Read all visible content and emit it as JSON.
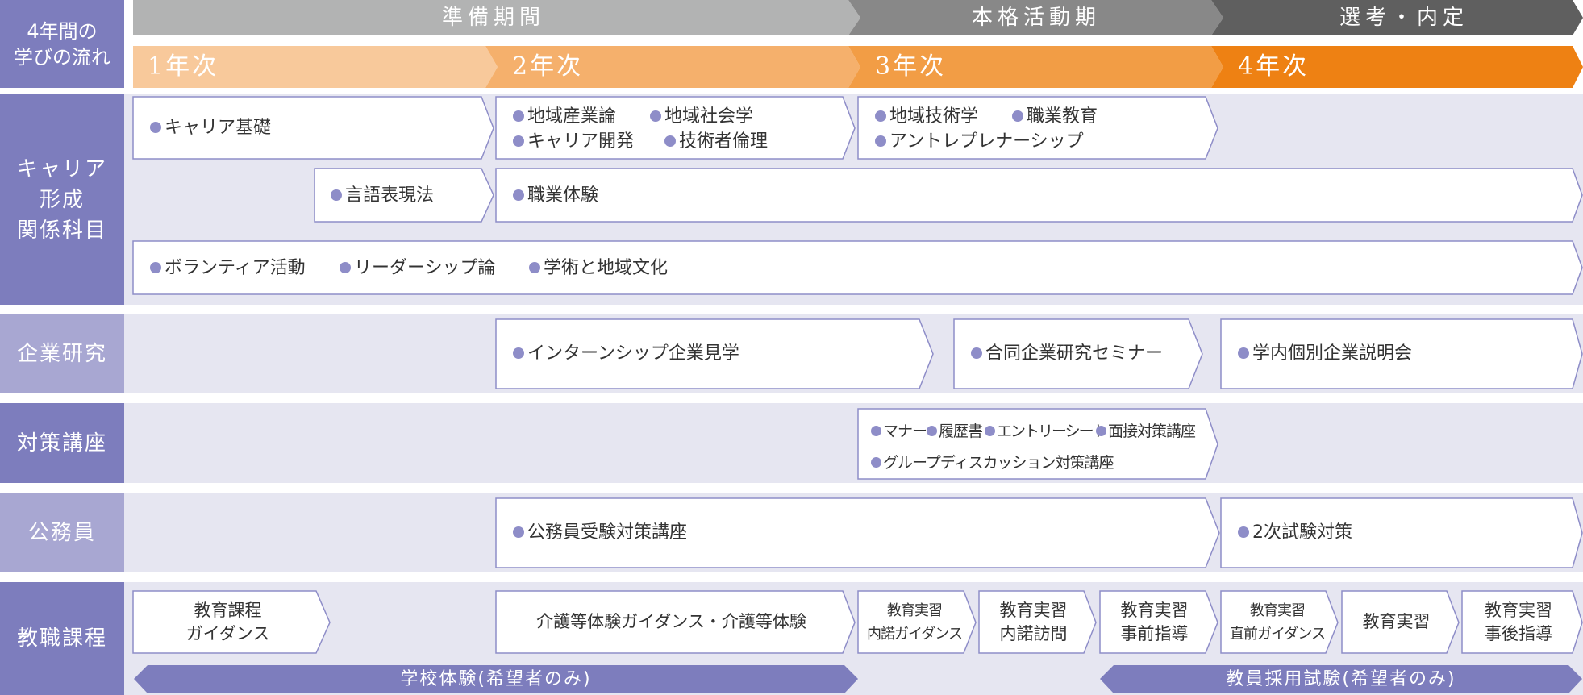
{
  "header": {
    "flow_label": "4年間の\n学びの流れ",
    "phases": [
      "準備期間",
      "本格活動期",
      "選考・内定"
    ],
    "years": [
      "1年次",
      "2年次",
      "3年次",
      "4年次"
    ]
  },
  "rows": {
    "career": {
      "label": "キャリア\n形成\n関係科目",
      "box1": "キャリア基礎",
      "box2_line1": [
        "地域産業論",
        "地域社会学"
      ],
      "box2_line2": [
        "キャリア開発",
        "技術者倫理"
      ],
      "box3_line1": [
        "地域技術学",
        "職業教育"
      ],
      "box3_line2": [
        "アントレプレナーシップ"
      ],
      "box4": "言語表現法",
      "box5": "職業体験",
      "box6": [
        "ボランティア活動",
        "リーダーシップ論",
        "学術と地域文化"
      ]
    },
    "company": {
      "label": "企業研究",
      "items": [
        "インターンシップ企業見学",
        "合同企業研究セミナー",
        "学内個別企業説明会"
      ]
    },
    "prep": {
      "label": "対策講座",
      "line1": [
        "マナー",
        "履歴書",
        "エントリーシート",
        "面接対策講座"
      ],
      "line2": [
        "グループディスカッション対策講座"
      ]
    },
    "civil": {
      "label": "公務員",
      "items": [
        "公務員受験対策講座",
        "2次試験対策"
      ]
    },
    "teaching": {
      "label": "教職課程",
      "boxes": [
        "教育課程\nガイダンス",
        "介護等体験ガイダンス・介護等体験",
        "教育実習\n内諾ガイダンス",
        "教育実習\n内諾訪問",
        "教育実習\n事前指導",
        "教育実習\n直前ガイダンス",
        "教育実習",
        "教育実習\n事後指導"
      ],
      "arrows": [
        "学校体験(希望者のみ)",
        "教員採用試験(希望者のみ)"
      ]
    }
  },
  "colors": {
    "label_dark": "#7d7dbd",
    "label_light": "#a8a7d2",
    "band_bg": "#e6e6f1",
    "phase1": "#b2b3b3",
    "phase2": "#888888",
    "phase3": "#5f5f5f",
    "year1": "#f8c99b",
    "year2": "#f5b06c",
    "year3": "#f29d45",
    "year4": "#ee8113",
    "dot": "#8e8dc8",
    "box_border": "#8e8dc8"
  }
}
